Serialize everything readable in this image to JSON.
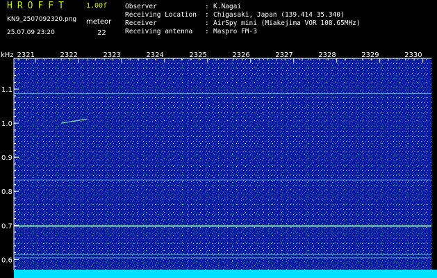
{
  "header": {
    "app_title": "HROFFT",
    "version": "1.00f",
    "filename": "KN9_2507092320.png",
    "datetime": "25.07.09 23:20",
    "meteor_label": "meteor",
    "meteor_count": "22"
  },
  "info": [
    {
      "label": "Observer",
      "sep": ":",
      "value": "K.Nagai"
    },
    {
      "label": "Receiving Location",
      "sep": ":",
      "value": "Chigasaki, Japan (139.414 35.340)"
    },
    {
      "label": "Receiver",
      "sep": ":",
      "value": "AirSpy mini (Miakejima VOR 108.65MHz)"
    },
    {
      "label": "Receiving antenna",
      "sep": ":",
      "value": "Maspro FM-3"
    }
  ],
  "chart_data": {
    "type": "heatmap",
    "ylabel": "kHz",
    "ylim": [
      0.57,
      1.19
    ],
    "xlim": [
      2320.5,
      2330.2
    ],
    "x_ticks": [
      "2321",
      "2322",
      "2323",
      "2324",
      "2325",
      "2326",
      "2327",
      "2328",
      "2329",
      "2330"
    ],
    "x_tick_values": [
      2321,
      2322,
      2323,
      2324,
      2325,
      2326,
      2327,
      2328,
      2329,
      2330
    ],
    "y_ticks": [
      "1.1",
      "1.0",
      "0.9",
      "0.8",
      "0.7",
      "0.6"
    ],
    "y_tick_values": [
      1.1,
      1.0,
      0.9,
      0.8,
      0.7,
      0.6
    ],
    "horizontal_lines_khz": [
      1.087,
      0.833,
      0.698,
      0.614,
      0.605
    ],
    "meteor_echoes": [
      {
        "x": [
          2321.6,
          2322.2
        ],
        "y": [
          1.0,
          1.012
        ]
      }
    ],
    "colors": {
      "background": "#0a1aa0",
      "axis": "#ffffff",
      "tick_label": "#ffffff",
      "line_strong": "#7fe8a0",
      "line_faint": "#6ec8e8",
      "bottom_band": "#00e0ff"
    }
  }
}
